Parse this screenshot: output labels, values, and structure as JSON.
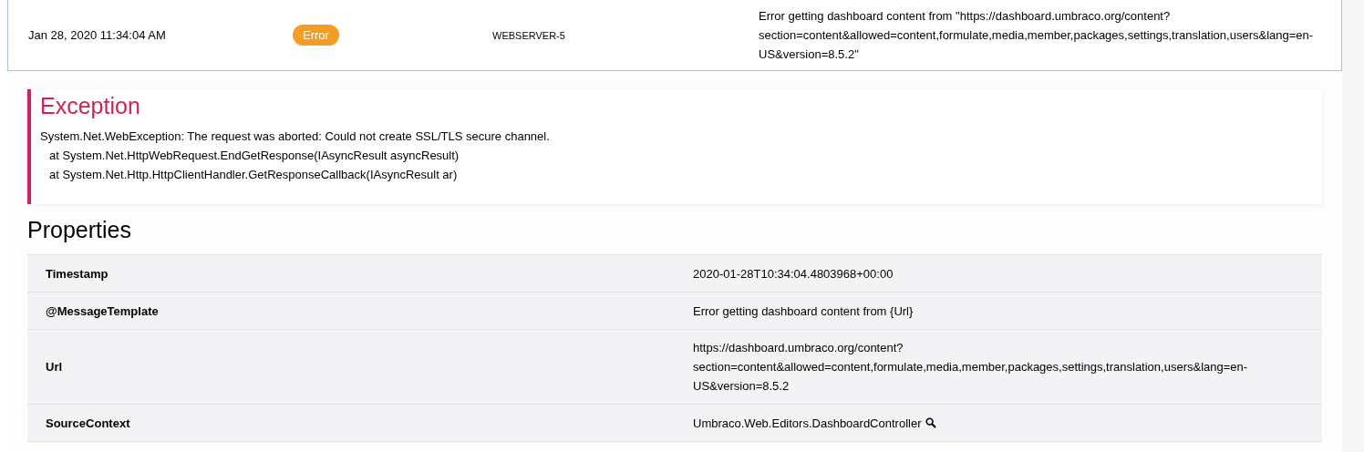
{
  "log_entry": {
    "timestamp": "Jan 28, 2020 11:34:04 AM",
    "level": {
      "label": "Error",
      "color": "#f79c23"
    },
    "machine": "WEBSERVER-5",
    "message": "Error getting dashboard content from \"https://dashboard.umbraco.org/content?section=content&allowed=content,formulate,media,member,packages,settings,translation,users&lang=en-US&version=8.5.2\"",
    "selected": true
  },
  "exception": {
    "title": "Exception",
    "lines": [
      "System.Net.WebException: The request was aborted: Could not create SSL/TLS secure channel.",
      "at System.Net.HttpWebRequest.EndGetResponse(IAsyncResult asyncResult)",
      "at System.Net.Http.HttpClientHandler.GetResponseCallback(IAsyncResult ar)"
    ]
  },
  "properties": {
    "title": "Properties",
    "rows": [
      {
        "name": "Timestamp",
        "value": "2020-01-28T10:34:04.4803968+00:00",
        "search": false
      },
      {
        "name": "@MessageTemplate",
        "value": "Error getting dashboard content from {Url}",
        "search": false
      },
      {
        "name": "Url",
        "value": "https://dashboard.umbraco.org/content?section=content&allowed=content,formulate,media,member,packages,settings,translation,users&lang=en-US&version=8.5.2",
        "search": false
      },
      {
        "name": "SourceContext",
        "value": "Umbraco.Web.Editors.DashboardController",
        "search": true
      }
    ]
  }
}
